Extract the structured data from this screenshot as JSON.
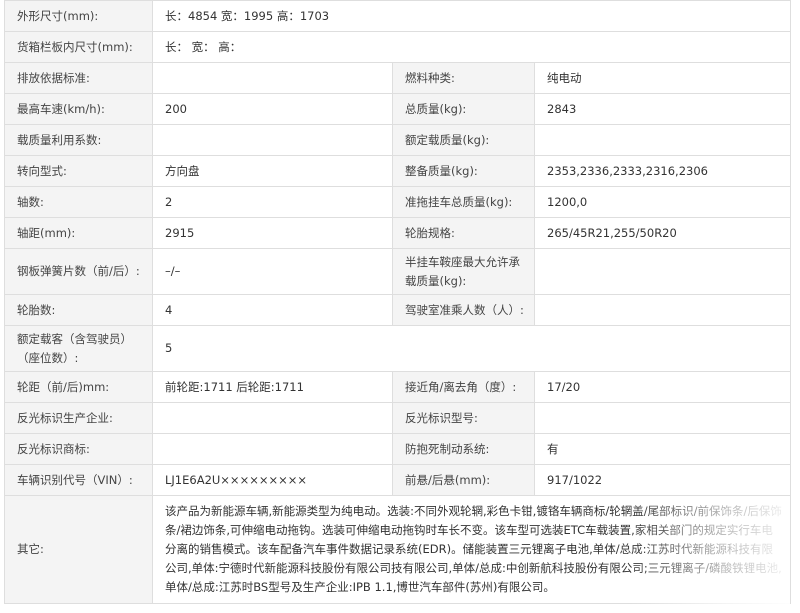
{
  "rows": {
    "r1": {
      "label": "外形尺寸(mm):",
      "value": "长：4854 宽：1995 高：1703"
    },
    "r2": {
      "label": "货箱栏板内尺寸(mm):",
      "value": "长： 宽： 高："
    },
    "r3": {
      "label": "排放依据标准:",
      "value": "",
      "label2": "燃料种类:",
      "value2": "纯电动"
    },
    "r4": {
      "label": "最高车速(km/h):",
      "value": "200",
      "label2": "总质量(kg):",
      "value2": "2843"
    },
    "r5": {
      "label": "载质量利用系数:",
      "value": "",
      "label2": "额定载质量(kg):",
      "value2": ""
    },
    "r6": {
      "label": "转向型式:",
      "value": "方向盘",
      "label2": "整备质量(kg):",
      "value2": "2353,2336,2333,2316,2306"
    },
    "r7": {
      "label": "轴数:",
      "value": "2",
      "label2": "准拖挂车总质量(kg):",
      "value2": "1200,0"
    },
    "r8": {
      "label": "轴距(mm):",
      "value": "2915",
      "label2": "轮胎规格:",
      "value2": "265/45R21,255/50R20"
    },
    "r9": {
      "label": "钢板弹簧片数（前/后）:",
      "value": "–/–",
      "label2": "半挂车鞍座最大允许承载质量(kg):",
      "value2": ""
    },
    "r10": {
      "label": "轮胎数:",
      "value": "4",
      "label2": "驾驶室准乘人数（人）:",
      "value2": ""
    },
    "r11": {
      "label": "额定载客（含驾驶员）（座位数）:",
      "value": "5"
    },
    "r12": {
      "label": "轮距（前/后)mm:",
      "value": "前轮距:1711 后轮距:1711",
      "label2": "接近角/离去角（度）:",
      "value2": "17/20"
    },
    "r13": {
      "label": "反光标识生产企业:",
      "value": "",
      "label2": "反光标识型号:",
      "value2": ""
    },
    "r14": {
      "label": "反光标识商标:",
      "value": "",
      "label2": "防抱死制动系统:",
      "value2": "有"
    },
    "r15": {
      "label": "车辆识别代号（VIN）:",
      "value": "LJ1E6A2U×××××××××",
      "label2": "前悬/后悬(mm):",
      "value2": "917/1022"
    },
    "r16": {
      "label": "其它:",
      "value": "该产品为新能源车辆,新能源类型为纯电动。选装:不同外观轮辋,彩色卡钳,镀铬车辆商标/轮辋盖/尾部标识/前保饰条/后保饰条/裙边饰条,可伸缩电动拖钩。选装可伸缩电动拖钩时车长不变。该车型可选装ETC车载装置,家相关部门的规定实行车电分离的销售模式。该车配备汽车事件数据记录系统(EDR)。储能装置三元锂离子电池,单体/总成:江苏时代新能源科技有限公司,单体:宁德时代新能源科技股份有限公司技有限公司,单体/总成:中创新航科技股份有限公司;三元锂离子/磷酸铁锂电池,单体/总成:江苏时BS型号及生产企业:IPB 1.1,博世汽车部件(苏州)有限公司。"
    }
  }
}
